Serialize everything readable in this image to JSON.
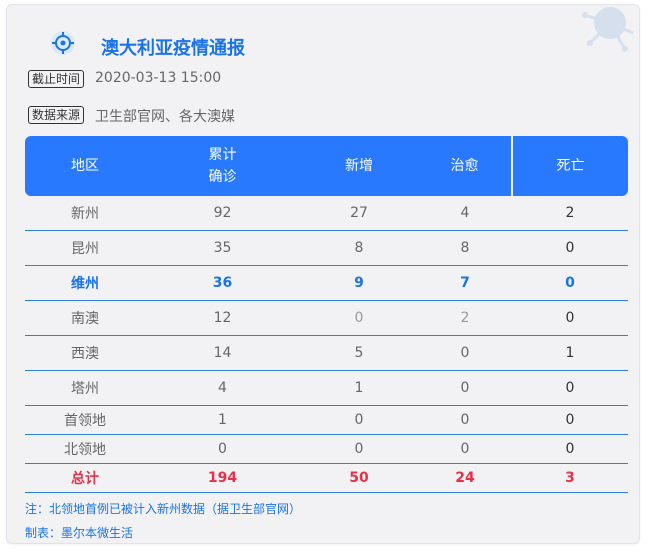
{
  "header": {
    "title": "澳大利亚疫情通报"
  },
  "meta": {
    "cutoff_label": "截止时间",
    "cutoff_value": "2020-03-13 15:00",
    "source_label": "数据来源",
    "source_value": "卫生部官网、各大澳媒"
  },
  "table": {
    "headers": {
      "region": "地区",
      "confirmed_line1": "累计",
      "confirmed_line2": "确诊",
      "new": "新增",
      "cured": "治愈",
      "death": "死亡"
    },
    "rows": [
      {
        "region": "新州",
        "confirmed": "92",
        "new": "27",
        "cured": "4",
        "death": "2"
      },
      {
        "region": "昆州",
        "confirmed": "35",
        "new": "8",
        "cured": "8",
        "death": "0"
      },
      {
        "region": "维州",
        "confirmed": "36",
        "new": "9",
        "cured": "7",
        "death": "0"
      },
      {
        "region": "南澳",
        "confirmed": "12",
        "new": "0",
        "cured": "2",
        "death": "0"
      },
      {
        "region": "西澳",
        "confirmed": "14",
        "new": "5",
        "cured": "0",
        "death": "1"
      },
      {
        "region": "塔州",
        "confirmed": "4",
        "new": "1",
        "cured": "0",
        "death": "0"
      },
      {
        "region": "首领地",
        "confirmed": "1",
        "new": "0",
        "cured": "0",
        "death": "0"
      },
      {
        "region": "北领地",
        "confirmed": "0",
        "new": "0",
        "cured": "0",
        "death": "0"
      }
    ],
    "total": {
      "region": "总计",
      "confirmed": "194",
      "new": "50",
      "cured": "24",
      "death": "3"
    }
  },
  "footer": {
    "note": "注：北领地首例已被计入新州数据（据卫生部官网）",
    "credit": "制表：墨尔本微生活"
  },
  "colors": {
    "accent": "#1a73e8",
    "header_bg": "#2979ff",
    "total": "#e8304b"
  },
  "icons": {
    "title": "target-icon",
    "decoration": "virus-icon"
  }
}
